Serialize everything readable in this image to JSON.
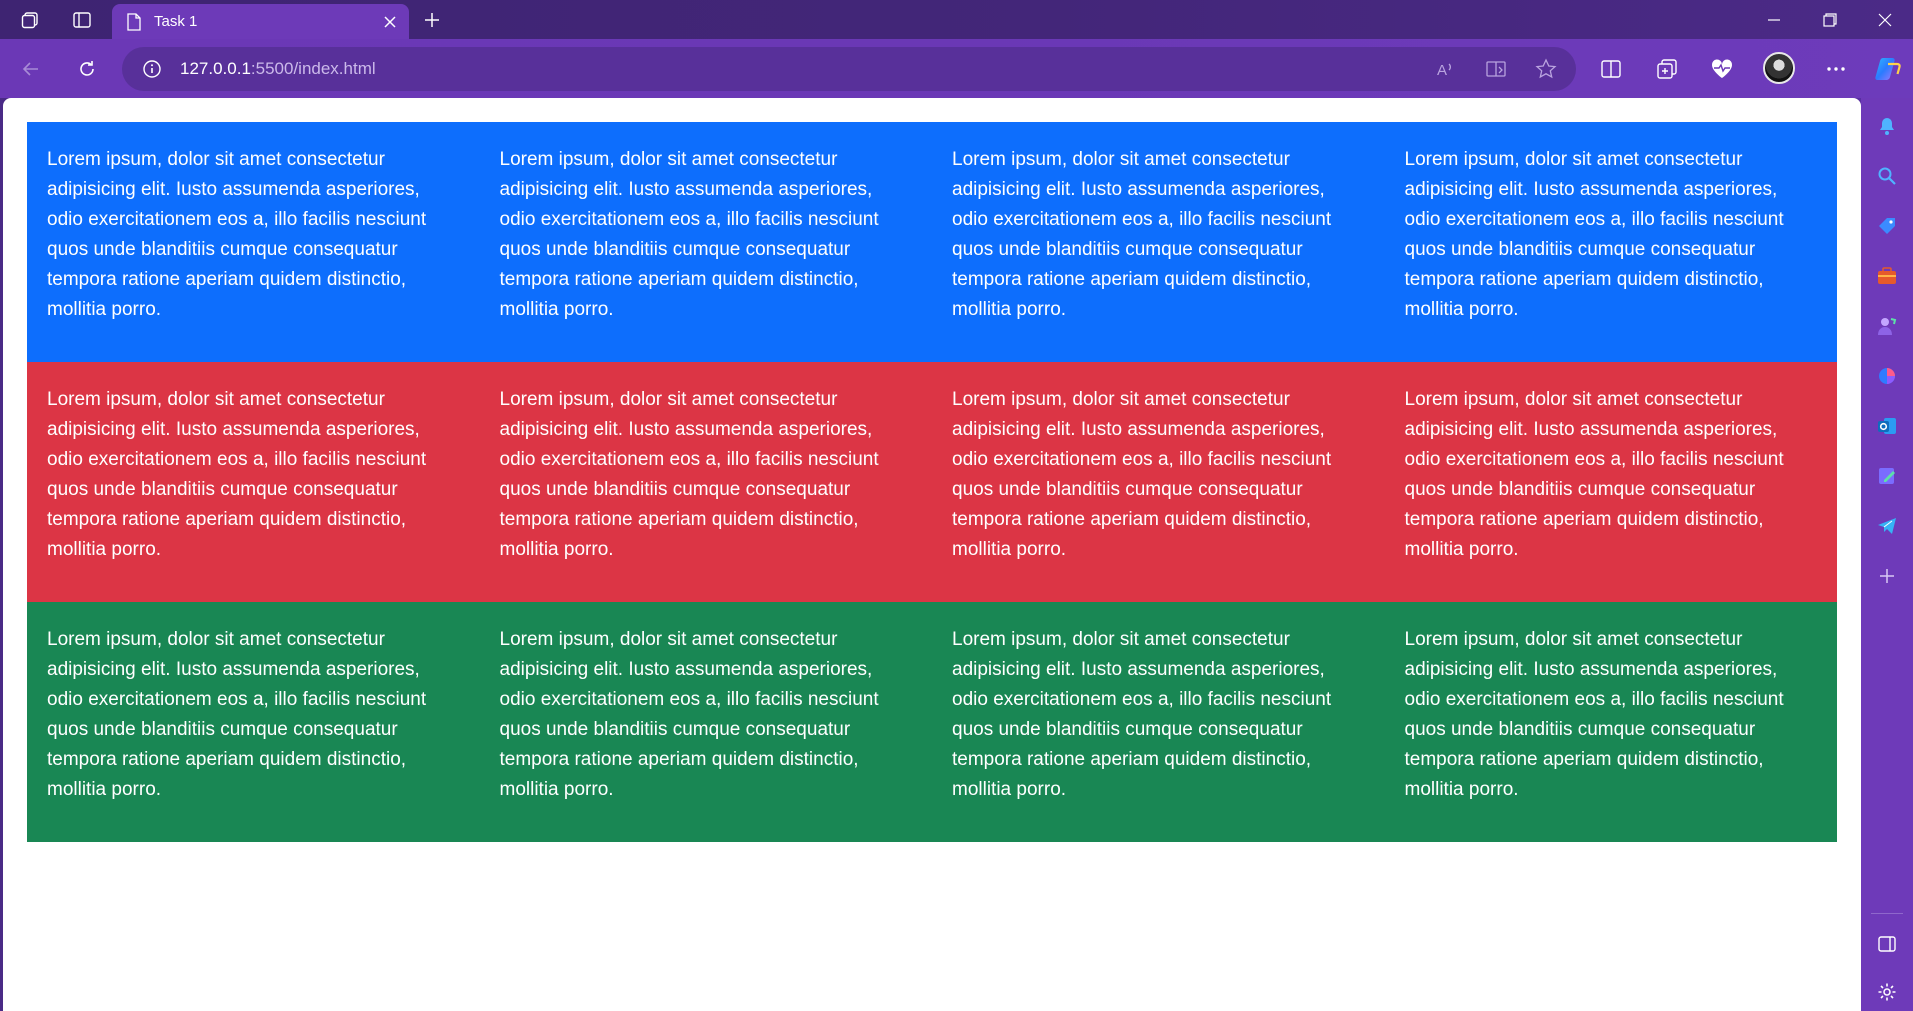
{
  "browser": {
    "tab": {
      "title": "Task 1"
    },
    "address_bar": {
      "url_host": "127.0.0.1",
      "url_rest": ":5500/index.html"
    }
  },
  "icons": {
    "tab_strip": [
      "workspaces-icon",
      "tab-actions-icon",
      "page-icon",
      "close-icon",
      "new-tab-icon"
    ],
    "window": [
      "minimize-icon",
      "restore-icon",
      "close-window-icon"
    ],
    "toolbar": [
      "back-icon",
      "refresh-icon",
      "info-icon",
      "read-aloud-icon",
      "immersive-reader-icon",
      "favorite-star-icon",
      "split-screen-icon",
      "collections-icon",
      "health-icon",
      "profile-avatar",
      "more-icon",
      "copilot-icon"
    ],
    "sidebar": [
      "notification-bell-icon",
      "search-icon",
      "shopping-tag-icon",
      "tools-briefcase-icon",
      "games-icon",
      "microsoft365-icon",
      "outlook-icon",
      "drop-icon",
      "telegram-icon",
      "add-icon",
      "hide-sidebar-icon",
      "settings-gear-icon"
    ]
  },
  "colors": {
    "row_blue": "#0d6efd",
    "row_red": "#dc3545",
    "row_green": "#198754",
    "browser_frame": "#6b38b6"
  },
  "page": {
    "rows": [
      {
        "color": "blue",
        "cells": [
          "Lorem ipsum, dolor sit amet consectetur adipisicing elit. Iusto assumenda asperiores, odio exercitationem eos a, illo facilis nesciunt quos unde blanditiis cumque consequatur tempora ratione aperiam quidem distinctio, mollitia porro.",
          "Lorem ipsum, dolor sit amet consectetur adipisicing elit. Iusto assumenda asperiores, odio exercitationem eos a, illo facilis nesciunt quos unde blanditiis cumque consequatur tempora ratione aperiam quidem distinctio, mollitia porro.",
          "Lorem ipsum, dolor sit amet consectetur adipisicing elit. Iusto assumenda asperiores, odio exercitationem eos a, illo facilis nesciunt quos unde blanditiis cumque consequatur tempora ratione aperiam quidem distinctio, mollitia porro.",
          "Lorem ipsum, dolor sit amet consectetur adipisicing elit. Iusto assumenda asperiores, odio exercitationem eos a, illo facilis nesciunt quos unde blanditiis cumque consequatur tempora ratione aperiam quidem distinctio, mollitia porro."
        ]
      },
      {
        "color": "red",
        "cells": [
          "Lorem ipsum, dolor sit amet consectetur adipisicing elit. Iusto assumenda asperiores, odio exercitationem eos a, illo facilis nesciunt quos unde blanditiis cumque consequatur tempora ratione aperiam quidem distinctio, mollitia porro.",
          "Lorem ipsum, dolor sit amet consectetur adipisicing elit. Iusto assumenda asperiores, odio exercitationem eos a, illo facilis nesciunt quos unde blanditiis cumque consequatur tempora ratione aperiam quidem distinctio, mollitia porro.",
          "Lorem ipsum, dolor sit amet consectetur adipisicing elit. Iusto assumenda asperiores, odio exercitationem eos a, illo facilis nesciunt quos unde blanditiis cumque consequatur tempora ratione aperiam quidem distinctio, mollitia porro.",
          "Lorem ipsum, dolor sit amet consectetur adipisicing elit. Iusto assumenda asperiores, odio exercitationem eos a, illo facilis nesciunt quos unde blanditiis cumque consequatur tempora ratione aperiam quidem distinctio, mollitia porro."
        ]
      },
      {
        "color": "green",
        "cells": [
          "Lorem ipsum, dolor sit amet consectetur adipisicing elit. Iusto assumenda asperiores, odio exercitationem eos a, illo facilis nesciunt quos unde blanditiis cumque consequatur tempora ratione aperiam quidem distinctio, mollitia porro.",
          "Lorem ipsum, dolor sit amet consectetur adipisicing elit. Iusto assumenda asperiores, odio exercitationem eos a, illo facilis nesciunt quos unde blanditiis cumque consequatur tempora ratione aperiam quidem distinctio, mollitia porro.",
          "Lorem ipsum, dolor sit amet consectetur adipisicing elit. Iusto assumenda asperiores, odio exercitationem eos a, illo facilis nesciunt quos unde blanditiis cumque consequatur tempora ratione aperiam quidem distinctio, mollitia porro.",
          "Lorem ipsum, dolor sit amet consectetur adipisicing elit. Iusto assumenda asperiores, odio exercitationem eos a, illo facilis nesciunt quos unde blanditiis cumque consequatur tempora ratione aperiam quidem distinctio, mollitia porro."
        ]
      }
    ]
  }
}
